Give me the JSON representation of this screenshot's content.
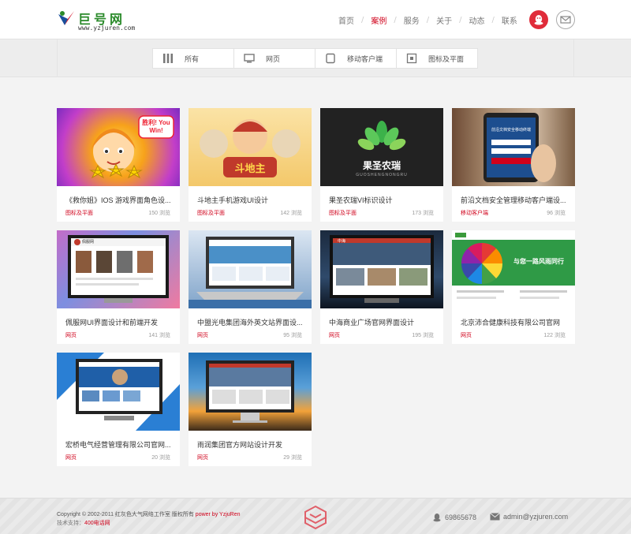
{
  "header": {
    "logo_title": "巨号网",
    "logo_url": "www.yzjuren.com",
    "nav": [
      {
        "label": "首页",
        "active": false
      },
      {
        "label": "案例",
        "active": true
      },
      {
        "label": "服务",
        "active": false
      },
      {
        "label": "关于",
        "active": false
      },
      {
        "label": "动态",
        "active": false
      },
      {
        "label": "联系",
        "active": false
      }
    ]
  },
  "filters": [
    {
      "label": "所有",
      "icon": "columns-icon"
    },
    {
      "label": "网页",
      "icon": "monitor-icon"
    },
    {
      "label": "移动客户端",
      "icon": "tablet-icon"
    },
    {
      "label": "图标及平面",
      "icon": "target-icon"
    }
  ],
  "cards": [
    {
      "title": "《救你姐》IOS 游戏界面角色设...",
      "tag": "图标及平面",
      "views": "150 浏览",
      "thumb_text": "胜利! You Win!"
    },
    {
      "title": "斗地主手机游戏UI设计",
      "tag": "图标及平面",
      "views": "142 浏览",
      "thumb_text": "斗地主"
    },
    {
      "title": "果圣农瑞VI标识设计",
      "tag": "图标及平面",
      "views": "173 浏览",
      "thumb_text": "果圣农瑞",
      "thumb_sub": "GUOSHENGNONGRU"
    },
    {
      "title": "前沿文档安全管理移动客户端设...",
      "tag": "移动客户端",
      "views": "96 浏览",
      "thumb_text": "前沿文档安全移动终端"
    },
    {
      "title": "佩服网UI界面设计和前端开发",
      "tag": "网页",
      "views": "141 浏览",
      "thumb_text": "佩服网"
    },
    {
      "title": "中盟光电集团海外英文站界面设...",
      "tag": "网页",
      "views": "95 浏览",
      "thumb_text": ""
    },
    {
      "title": "中海商业广场官网界面设计",
      "tag": "网页",
      "views": "195 浏览",
      "thumb_text": "中海"
    },
    {
      "title": "北京沛合健康科技有限公司官网",
      "tag": "网页",
      "views": "122 浏览",
      "thumb_text": "与您一路风雨同行"
    },
    {
      "title": "宏桥电气经营管理有限公司官网...",
      "tag": "网页",
      "views": "20 浏览",
      "thumb_text": ""
    },
    {
      "title": "雨润集团官方网站设计开发",
      "tag": "网页",
      "views": "29 浏览",
      "thumb_text": ""
    }
  ],
  "footer": {
    "copyright_prefix": "Copyright © 2002-2011 红灰色大气网络工作室 版权所有 ",
    "copyright_link": "power by YzjuRen",
    "support_prefix": "技术支持：",
    "support_link": "400电话网",
    "qq": "69865678",
    "email": "admin@yzjuren.com"
  },
  "colors": {
    "accent": "#d0021b",
    "logo_green": "#2a8a2a",
    "background": "#f3f3f3"
  }
}
